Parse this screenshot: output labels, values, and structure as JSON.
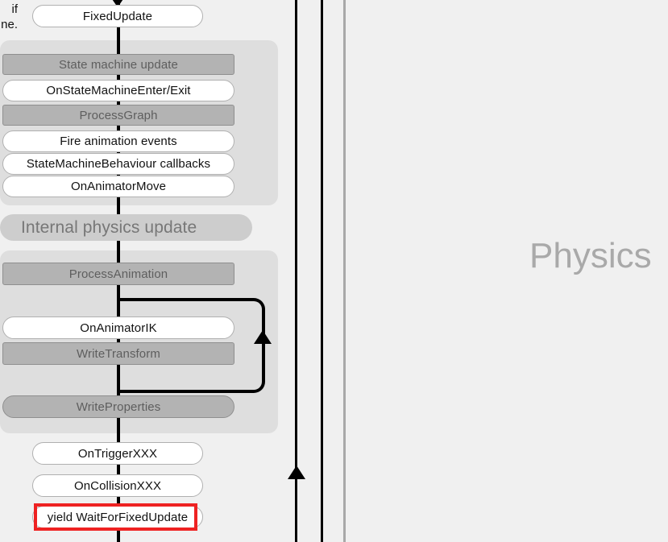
{
  "diagram": {
    "title_side_label": "Physics",
    "clipped_left_text": {
      "line1": "if",
      "line2": "ne."
    },
    "entry_node": {
      "label": "FixedUpdate"
    },
    "panels": [
      {
        "name": "state-machine-panel"
      },
      {
        "name": "physics-update-panel"
      }
    ],
    "section_header": {
      "label": "Internal physics update"
    },
    "state_machine_nodes": [
      {
        "label": "State machine update",
        "style": "gray"
      },
      {
        "label": "OnStateMachineEnter/Exit",
        "style": "white"
      },
      {
        "label": "ProcessGraph",
        "style": "gray"
      },
      {
        "label": "Fire animation events",
        "style": "white"
      },
      {
        "label": "StateMachineBehaviour callbacks",
        "style": "white"
      },
      {
        "label": "OnAnimatorMove",
        "style": "white"
      }
    ],
    "physics_nodes": [
      {
        "label": "ProcessAnimation",
        "style": "gray"
      },
      {
        "label": "OnAnimatorIK",
        "style": "white"
      },
      {
        "label": "WriteTransform",
        "style": "gray"
      },
      {
        "label": "WriteProperties",
        "style": "gray-pill"
      }
    ],
    "post_nodes": [
      {
        "label": "OnTriggerXXX",
        "style": "white"
      },
      {
        "label": "OnCollisionXXX",
        "style": "white"
      },
      {
        "label": "yield WaitForFixedUpdate",
        "style": "white",
        "highlighted": true
      }
    ],
    "colors": {
      "background": "#f0f0f0",
      "panel": "#dedede",
      "gray_node_fill": "#b3b3b3",
      "gray_node_text": "#5e5e5e",
      "white_node_fill": "#ffffff",
      "header_bar_fill": "#cdcdcd",
      "side_label_text": "#a9a9a9",
      "flow_line": "#000000",
      "highlight": "#ee2222"
    },
    "timeline_lines": [
      {
        "name": "loop-back-timeline",
        "color": "#000000"
      },
      {
        "name": "secondary-timeline",
        "color": "#000000"
      },
      {
        "name": "divider-timeline",
        "color": "#a8a8a8"
      }
    ]
  }
}
